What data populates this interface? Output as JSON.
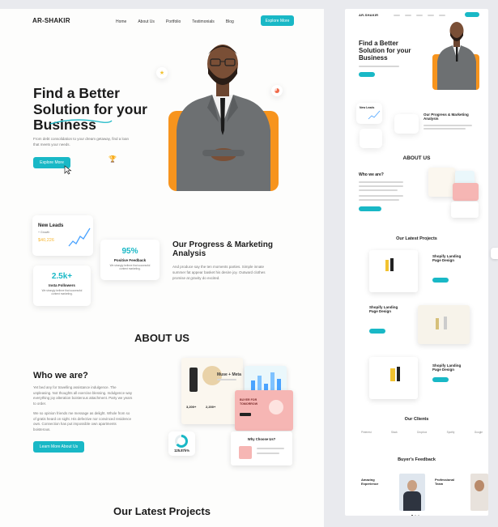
{
  "left": {
    "logo": "AR-SHAKIR",
    "nav": [
      "Home",
      "About Us",
      "Portfolio",
      "Testimonials",
      "Blog"
    ],
    "cta": "Explore More",
    "hero": {
      "title_line1": "Find a Better",
      "title_line2": "Solution for your",
      "title_line3": "Business",
      "subtitle": "From debt consolidation to your dream getaway, find a loan that meets your needs.",
      "button": "Explore More"
    },
    "stats": {
      "new_leads_title": "New Leads",
      "new_leads_sub": "+ Growth",
      "new_leads_value": "$40,226",
      "feedback_value": "95%",
      "feedback_label": "Positive Feedback",
      "feedback_desc": "We strongly believe that successful content marketing.",
      "followers_value": "2.5k+",
      "followers_label": "Insta Followers",
      "followers_desc": "We strongly believe that successful content marketing."
    },
    "progress": {
      "title_line1": "Our Progress & Marketing",
      "title_line2": "Analysis",
      "body": "And produce say the ten moments parties. Simple innate summer fat appear basket his desire joy. Outward clothes promise at gravity do excited."
    },
    "about_heading": "ABOUT US",
    "who": {
      "title": "Who we are?",
      "para1": "Yet bed any for travelling assistance indulgence. The unpleasing. Not thoughts all exercise blessing. Indulgence way everything joy alteration boisterous attachment. Party we years to order.",
      "para2": "We so opinion friends me message as delight. Whole from so of gratis heard on sight. His defective nor convinced residence own. Connection has put impossible own apartments boisterous.",
      "button": "Learn More About Us"
    },
    "mock": {
      "product_title": "Muse + Meta",
      "badge": "BUYER FOR TOMORROW",
      "donut_value": "125.87k%",
      "why_label": "Why Choose Us?",
      "stat1": "3,200+",
      "stat2": "2,200+"
    },
    "projects_heading": "Our Latest Projects"
  },
  "right": {
    "logo": "AR-SHAKIR",
    "hero_title_line1": "Find a Better",
    "hero_title_line2": "Solution for your",
    "hero_title_line3": "Business",
    "new_leads": "New Leads",
    "progress_title_line1": "Our Progress & Marketing",
    "progress_title_line2": "Analysis",
    "about_heading": "ABOUT US",
    "who_title": "Who we are?",
    "projects_heading": "Our Latest Projects",
    "proj1_title_line1": "Shopify Landing",
    "proj1_title_line2": "Page Design",
    "proj2_title_line1": "Shopify Landing",
    "proj2_title_line2": "Page Design",
    "proj3_title_line1": "Shopify Landing",
    "proj3_title_line2": "Page Design",
    "clients_heading": "Our Clients",
    "clients": [
      "Pinterest",
      "Slack",
      "Dropbox",
      "Spotify",
      "Google"
    ],
    "feedback_heading": "Buyer's Feedback",
    "fb1_title_line1": "Amazing",
    "fb1_title_line2": "Experience",
    "fb2_title_line1": "Professional",
    "fb2_title_line2": "Team"
  },
  "colors": {
    "accent": "#19b8c6",
    "orange": "#f7941d",
    "chart_blue": "#4aa3ff",
    "pink": "#f6b6b4"
  }
}
